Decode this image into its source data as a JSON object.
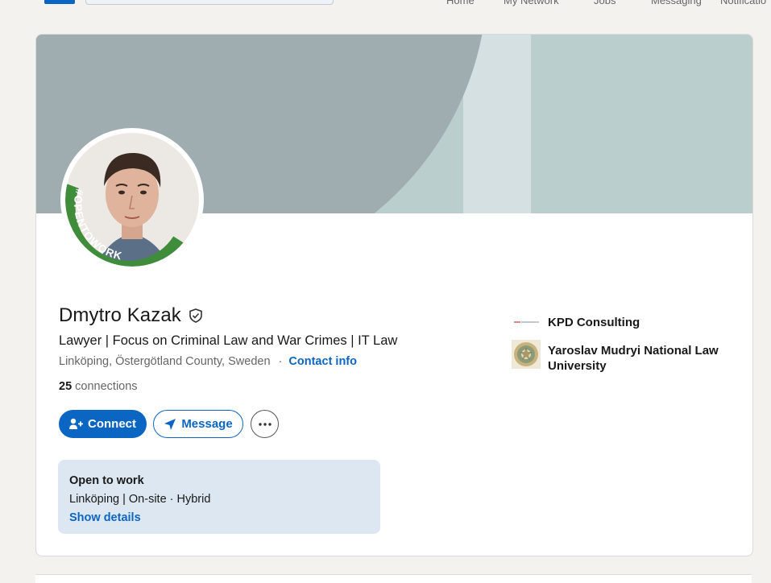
{
  "nav": {
    "items": [
      "Home",
      "My Network",
      "Jobs",
      "Messaging",
      "Notificatio"
    ]
  },
  "profile": {
    "name": "Dmytro Kazak",
    "headline": "Lawyer | Focus on Criminal Law and War Crimes | IT Law",
    "location": "Linköping, Östergötland County, Sweden",
    "separator": "·",
    "contact_label": "Contact info",
    "connections_count": "25",
    "connections_label": "connections",
    "avatar_frame_text": "#OPENTOWORK",
    "verified_icon": "shield-check-icon"
  },
  "actions": {
    "connect_label": "Connect",
    "message_label": "Message",
    "more_icon": "more-horizontal-icon"
  },
  "open_to_work": {
    "title": "Open to work",
    "detail": "Linköping | On-site · Hybrid",
    "link": "Show details"
  },
  "sidebar": {
    "items": [
      {
        "label": "KPD Consulting",
        "logo": "kpd-consulting-logo"
      },
      {
        "label": "Yaroslav Mudryi National Law University",
        "logo": "university-crest-logo"
      }
    ]
  },
  "colors": {
    "brand": "#0a66c2",
    "opentowork_green": "#3f8c3a",
    "banner_light": "#bacfcd",
    "banner_dark": "#9fadb1",
    "otw_bg": "#dde7f1"
  }
}
